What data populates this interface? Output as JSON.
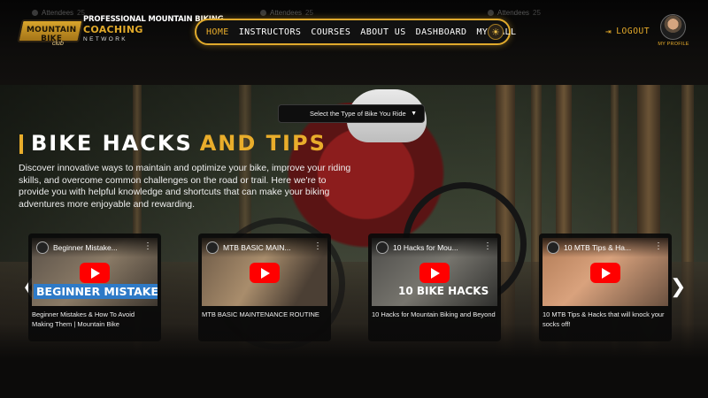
{
  "header": {
    "ghost_items": [
      {
        "label": "Attendees",
        "count": "25"
      },
      {
        "label": "Attendees",
        "count": "25"
      },
      {
        "label": "Attendees",
        "count": "25"
      }
    ],
    "logo": {
      "badge": "MOUNTAIN BIKE",
      "sub": "club",
      "line1": "PROFESSIONAL MOUNTAIN BIKING",
      "line2": "COACHING",
      "line3": "NETWORK"
    },
    "nav": [
      {
        "label": "HOME",
        "active": true
      },
      {
        "label": "INSTRUCTORS",
        "active": false
      },
      {
        "label": "COURSES",
        "active": false
      },
      {
        "label": "ABOUT US",
        "active": false
      },
      {
        "label": "DASHBOARD",
        "active": false
      },
      {
        "label": "MY WALL",
        "active": false
      }
    ],
    "theme_icon": "sun-icon",
    "logout_label": "LOGOUT",
    "profile_label": "MY PROFILE"
  },
  "hero": {
    "bike_select_label": "Select the Type of Bike You Ride",
    "title_white": "BIKE HACKS",
    "title_gold": "AND TIPS",
    "description": "Discover innovative ways to maintain and optimize your bike, improve your riding skills, and overcome common challenges on the road or trail. Here we're to provide you with helpful knowledge and shortcuts that can make your biking adventures more enjoyable and rewarding."
  },
  "videos": [
    {
      "thumb_title": "Beginner Mistake...",
      "overlay": "BEGINNER MISTAKES",
      "caption": "Beginner Mistakes & How To Avoid Making Them | Mountain Bike"
    },
    {
      "thumb_title": "MTB BASIC MAIN...",
      "overlay": "",
      "caption": "MTB BASIC MAINTENANCE ROUTINE"
    },
    {
      "thumb_title": "10 Hacks for Mou...",
      "overlay": "10 BIKE HACKS",
      "caption": "10 Hacks for Mountain Biking and Beyond"
    },
    {
      "thumb_title": "10 MTB Tips & Ha...",
      "overlay": "",
      "caption": "10 MTB Tips & Hacks that will knock your socks off!"
    }
  ],
  "colors": {
    "accent": "#e9ad2b",
    "youtube_red": "#ff0000",
    "background": "#0c0b0a"
  }
}
